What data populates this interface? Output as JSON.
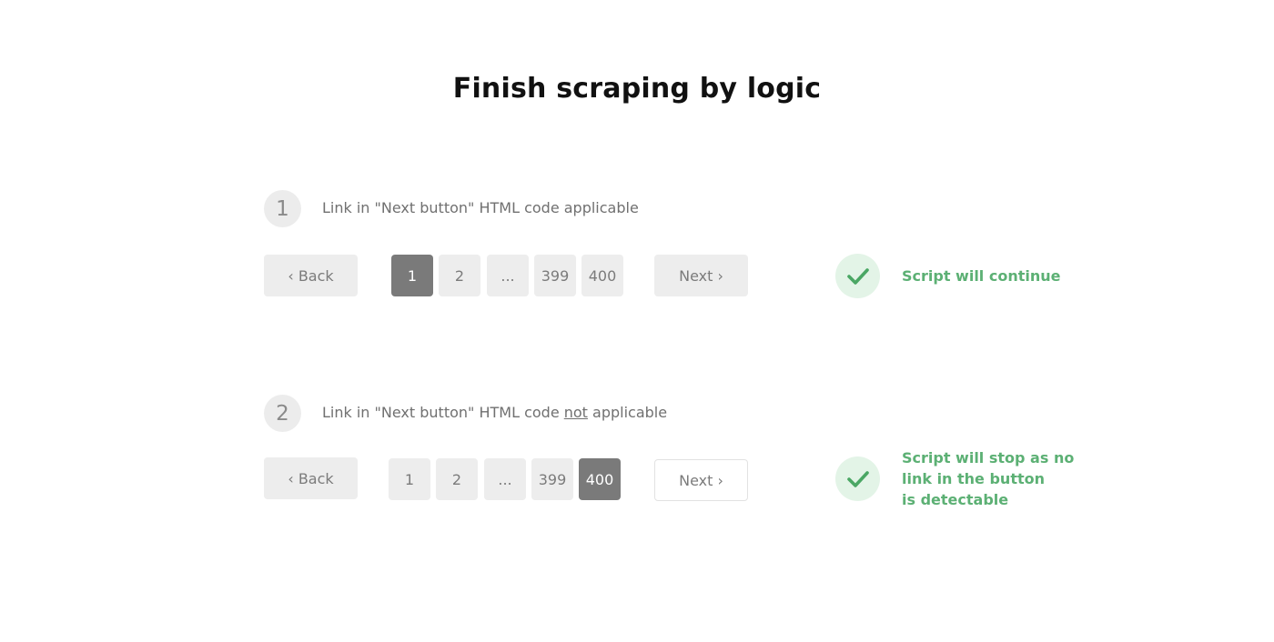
{
  "title": "Finish scraping by logic",
  "colors": {
    "active_page": "#7a7a7a",
    "button_bg": "#ededed",
    "success_green": "#5cb074",
    "check_bg": "#e3f4e7"
  },
  "steps": [
    {
      "number": "1",
      "text_before": "Link in \"Next button\" HTML code applicable",
      "text_emphasis": "",
      "text_after": "",
      "back_label": "‹ Back",
      "pages": [
        "1",
        "2",
        "...",
        "399",
        "400"
      ],
      "active_page": "1",
      "next_label": "Next ›",
      "result_icon": "checkmark-icon",
      "result_lines": [
        "Script will continue"
      ]
    },
    {
      "number": "2",
      "text_before": "Link in \"Next button\" HTML code ",
      "text_emphasis": "not",
      "text_after": " applicable",
      "back_label": "‹ Back",
      "pages": [
        "1",
        "2",
        "...",
        "399",
        "400"
      ],
      "active_page": "400",
      "next_label": "Next ›",
      "result_icon": "checkmark-icon",
      "result_lines": [
        "Script will stop as no",
        "link in the button",
        "is detectable"
      ]
    }
  ]
}
